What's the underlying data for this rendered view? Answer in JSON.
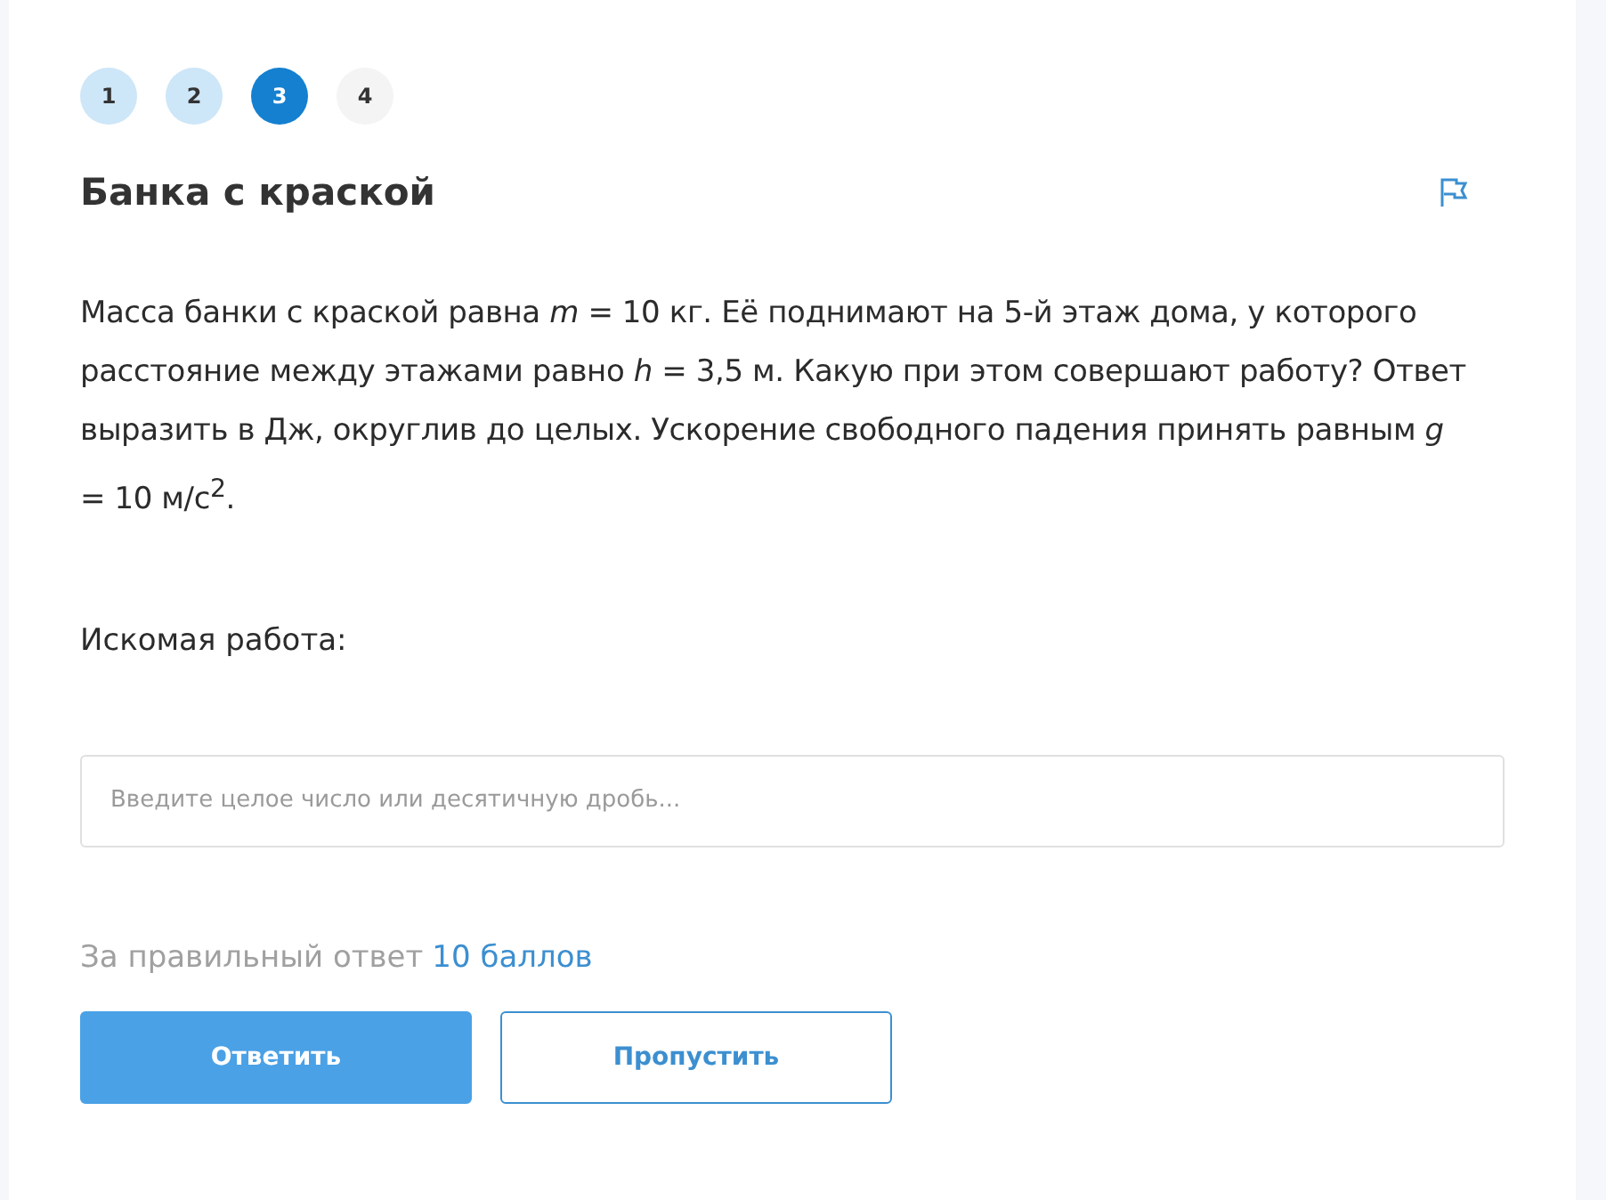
{
  "steps": [
    {
      "label": "1",
      "selected": false,
      "answered": true
    },
    {
      "label": "2",
      "selected": false,
      "answered": true
    },
    {
      "label": "3",
      "selected": true,
      "answered": false
    },
    {
      "label": "4",
      "selected": false,
      "answered": false
    }
  ],
  "task": {
    "title": "Банка с краской",
    "flagged": false,
    "text": "Масса банки с краской равна *m* = 10 кг. Её поднимают на 5-й этаж дома, у которого расстояние между этажами равно *h* = 3,5 м. Какую при этом совершают работу? Ответ выразить в Дж, округлив до целых. Ускорение свободного падения принять равным *g* = 10 м/с$^{2}$.",
    "question": "Искомая работа:",
    "answer": {
      "placeholder": "Введите целое число или десятичную дробь..."
    },
    "reward_text": "За правильный ответ",
    "reward_points": "10 баллов",
    "buttons": [
      {
        "label": "Ответить",
        "kind": "primary"
      },
      {
        "label": "Пропустить",
        "kind": "secondary"
      }
    ]
  }
}
